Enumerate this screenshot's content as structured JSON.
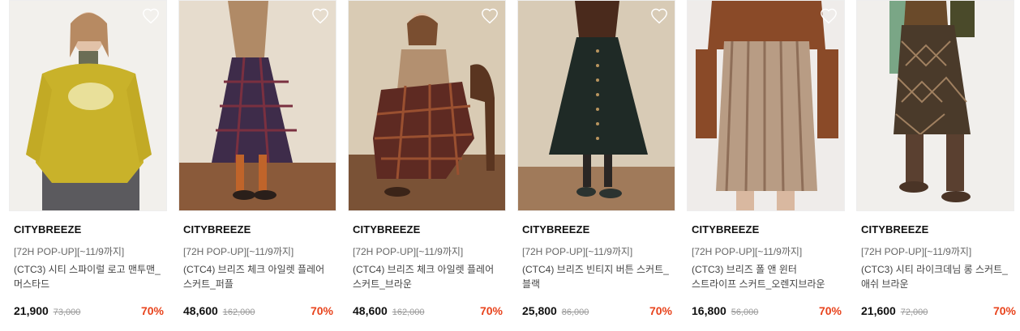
{
  "colors": {
    "discount": "#e8431c",
    "brand_text": "#111111",
    "muted_text": "#999999"
  },
  "products": [
    {
      "brand": "CITYBREEZE",
      "promo": "[72H POP-UP][~11/9까지]",
      "name": "(CTC3) 시티 스파이럴 로고 맨투맨_머스타드",
      "price": "21,900",
      "original_price": "73,000",
      "discount": "70%",
      "wishlist_icon": "heart-outline-icon"
    },
    {
      "brand": "CITYBREEZE",
      "promo": "[72H POP-UP][~11/9까지]",
      "name": "(CTC4) 브리즈 체크 아일렛 플레어 스커트_퍼플",
      "price": "48,600",
      "original_price": "162,000",
      "discount": "70%",
      "wishlist_icon": "heart-outline-icon"
    },
    {
      "brand": "CITYBREEZE",
      "promo": "[72H POP-UP][~11/9까지]",
      "name": "(CTC4) 브리즈 체크 아일렛 플레어 스커트_브라운",
      "price": "48,600",
      "original_price": "162,000",
      "discount": "70%",
      "wishlist_icon": "heart-outline-icon"
    },
    {
      "brand": "CITYBREEZE",
      "promo": "[72H POP-UP][~11/9까지]",
      "name": "(CTC4) 브리즈 빈티지 버튼 스커트_블랙",
      "price": "25,800",
      "original_price": "86,000",
      "discount": "70%",
      "wishlist_icon": "heart-outline-icon"
    },
    {
      "brand": "CITYBREEZE",
      "promo": "[72H POP-UP][~11/9까지]",
      "name": "(CTC3) 브리즈 폴 앤 윈터 스트라이프 스커트_오렌지브라운",
      "price": "16,800",
      "original_price": "56,000",
      "discount": "70%",
      "wishlist_icon": "heart-outline-icon"
    },
    {
      "brand": "CITYBREEZE",
      "promo": "[72H POP-UP][~11/9까지]",
      "name": "(CTC3) 시티 라이크데님 롱 스커트_애쉬 브라운",
      "price": "21,600",
      "original_price": "72,000",
      "discount": "70%",
      "wishlist_icon": "heart-outline-icon"
    }
  ]
}
